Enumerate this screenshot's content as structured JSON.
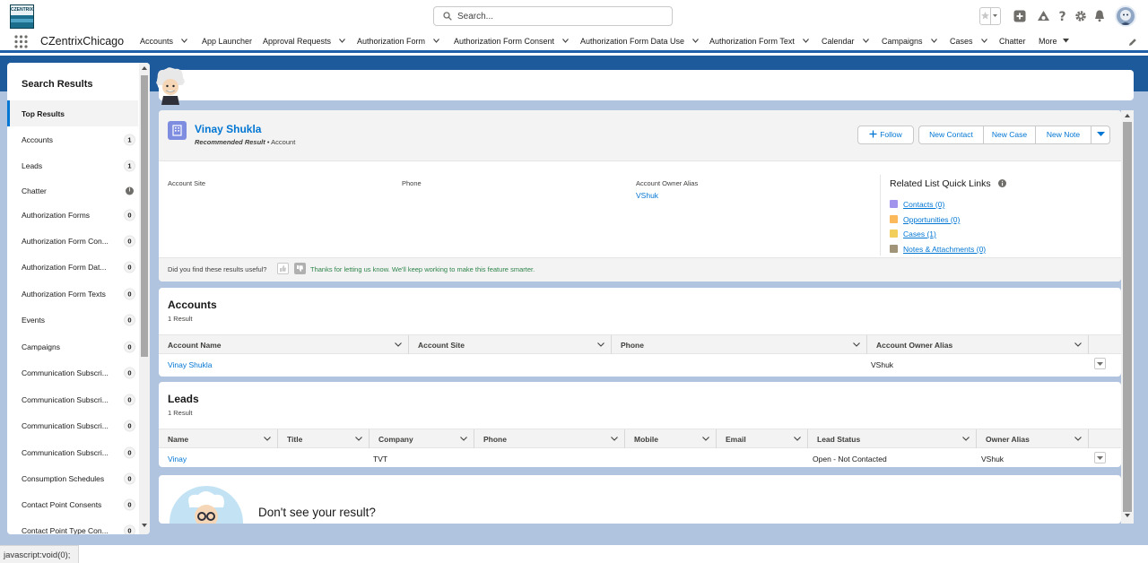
{
  "header": {
    "logo_text": "CZENTRIX",
    "search_placeholder": "Search...",
    "icons": [
      "favorites-star-icon",
      "favorites-dropdown-icon",
      "global-actions-icon",
      "trailhead-icon",
      "help-icon",
      "setup-gear-icon",
      "notifications-bell-icon",
      "user-avatar"
    ]
  },
  "nav": {
    "app_name": "CZentrixChicago",
    "items": [
      {
        "label": "Accounts",
        "dropdown": true
      },
      {
        "label": "App Launcher",
        "dropdown": false
      },
      {
        "label": "Approval Requests",
        "dropdown": true
      },
      {
        "label": "Authorization Form",
        "dropdown": true
      },
      {
        "label": "Authorization Form Consent",
        "dropdown": true
      },
      {
        "label": "Authorization Form Data Use",
        "dropdown": true
      },
      {
        "label": "Authorization Form Text",
        "dropdown": true
      },
      {
        "label": "Calendar",
        "dropdown": true
      },
      {
        "label": "Campaigns",
        "dropdown": true
      },
      {
        "label": "Cases",
        "dropdown": true
      },
      {
        "label": "Chatter",
        "dropdown": false
      },
      {
        "label": "More",
        "dropdown": true
      }
    ]
  },
  "sidebar": {
    "title": "Search Results",
    "items": [
      {
        "label": "Top Results",
        "count": "",
        "active": true
      },
      {
        "label": "Accounts",
        "count": "1"
      },
      {
        "label": "Leads",
        "count": "1"
      },
      {
        "label": "Chatter",
        "count": "",
        "info": true
      },
      {
        "label": "Authorization Forms",
        "count": "0"
      },
      {
        "label": "Authorization Form Con...",
        "count": "0"
      },
      {
        "label": "Authorization Form Dat...",
        "count": "0"
      },
      {
        "label": "Authorization Form Texts",
        "count": "0"
      },
      {
        "label": "Events",
        "count": "0"
      },
      {
        "label": "Campaigns",
        "count": "0"
      },
      {
        "label": "Communication Subscri...",
        "count": "0"
      },
      {
        "label": "Communication Subscri...",
        "count": "0"
      },
      {
        "label": "Communication Subscri...",
        "count": "0"
      },
      {
        "label": "Communication Subscri...",
        "count": "0"
      },
      {
        "label": "Consumption Schedules",
        "count": "0"
      },
      {
        "label": "Contact Point Consents",
        "count": "0"
      },
      {
        "label": "Contact Point Type Con...",
        "count": "0"
      }
    ]
  },
  "top_result": {
    "name": "Vinay Shukla",
    "recommended": "Recommended Result",
    "type": "Account",
    "buttons": {
      "follow": "Follow",
      "new_contact": "New Contact",
      "new_case": "New Case",
      "new_note": "New Note"
    },
    "fields": {
      "account_site_label": "Account Site",
      "phone_label": "Phone",
      "owner_alias_label": "Account Owner Alias",
      "owner_alias_value": "VShuk"
    },
    "related": {
      "title": "Related List Quick Links",
      "links": [
        {
          "label": "Contacts (0)",
          "color": "#a094ed"
        },
        {
          "label": "Opportunities (0)",
          "color": "#fcb95b"
        },
        {
          "label": "Cases (1)",
          "color": "#f2cf5b"
        },
        {
          "label": "Notes & Attachments (0)",
          "color": "#a09479"
        }
      ]
    },
    "feedback": {
      "question": "Did you find these results useful?",
      "thanks": "Thanks for letting us know. We'll keep working to make this feature smarter."
    }
  },
  "accounts_list": {
    "title": "Accounts",
    "subtitle": "1 Result",
    "columns": [
      "Account Name",
      "Account Site",
      "Phone",
      "Account Owner Alias"
    ],
    "rows": [
      {
        "name": "Vinay Shukla",
        "site": "",
        "phone": "",
        "owner": "VShuk"
      }
    ]
  },
  "leads_list": {
    "title": "Leads",
    "subtitle": "1 Result",
    "columns": [
      "Name",
      "Title",
      "Company",
      "Phone",
      "Mobile",
      "Email",
      "Lead Status",
      "Owner Alias"
    ],
    "rows": [
      {
        "name": "Vinay",
        "title": "",
        "company": "TVT",
        "phone": "",
        "mobile": "",
        "email": "",
        "status": "Open - Not Contacted",
        "owner": "VShuk"
      }
    ]
  },
  "not_found": {
    "question": "Don't see your result?"
  },
  "status_bar": {
    "text": "javascript:void(0);"
  },
  "colors": {
    "brand_blue": "#0176d3",
    "nav_accent": "#1f5fa8",
    "background": "#b0c4df"
  }
}
